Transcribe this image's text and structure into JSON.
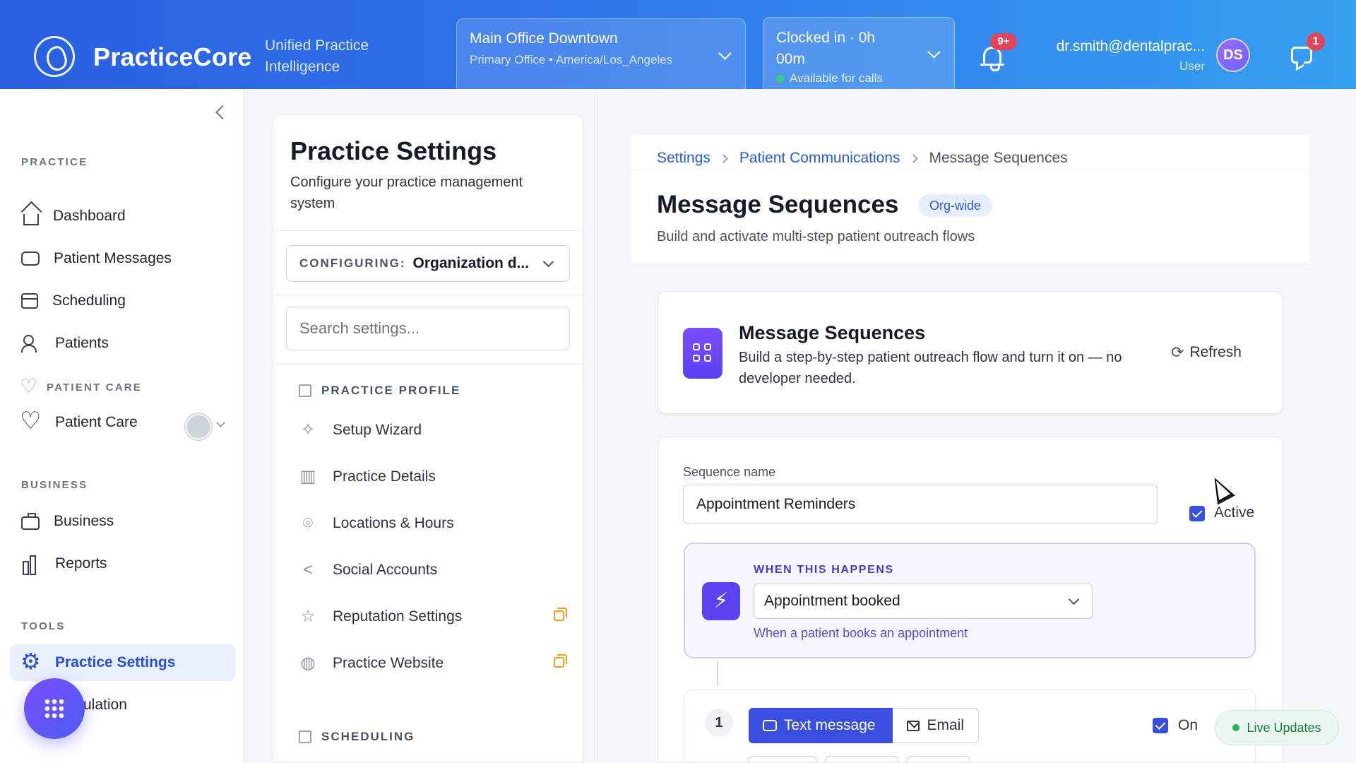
{
  "header": {
    "brand": "PracticeCore",
    "tagline": "Unified Practice Intelligence",
    "location": {
      "name": "Main Office Downtown",
      "sub": "Primary Office • America/Los_Angeles"
    },
    "clock": {
      "status": "Clocked in · 0h 00m",
      "availability": "Available for calls"
    },
    "notifications_badge": "9+",
    "user": {
      "email": "dr.smith@dentalprac...",
      "role": "User",
      "initials": "DS"
    },
    "messages_badge": "1"
  },
  "sidebar": {
    "sections": [
      {
        "label": "PRACTICE"
      },
      {
        "label": "PATIENT CARE"
      },
      {
        "label": "BUSINESS"
      },
      {
        "label": "TOOLS"
      }
    ],
    "items": {
      "dashboard": "Dashboard",
      "patient_messages": "Patient Messages",
      "scheduling": "Scheduling",
      "patients": "Patients",
      "patient_care": "Patient Care",
      "business": "Business",
      "reports": "Reports",
      "practice_settings": "Practice Settings",
      "simulation_partial": "ulation"
    }
  },
  "settings_panel": {
    "title": "Practice Settings",
    "subtitle": "Configure your practice management system",
    "configuring_label": "CONFIGURING:",
    "configuring_value": "Organization d...",
    "search_placeholder": "Search settings...",
    "groups": {
      "practice_profile": "PRACTICE PROFILE",
      "scheduling": "SCHEDULING"
    },
    "items": [
      {
        "label": "Setup Wizard",
        "icon": "sparkles-icon"
      },
      {
        "label": "Practice Details",
        "icon": "building-icon"
      },
      {
        "label": "Locations & Hours",
        "icon": "map-pin-icon"
      },
      {
        "label": "Social Accounts",
        "icon": "share-icon"
      },
      {
        "label": "Reputation Settings",
        "icon": "star-icon"
      },
      {
        "label": "Practice Website",
        "icon": "globe-icon"
      }
    ]
  },
  "main": {
    "breadcrumb": [
      "Settings",
      "Patient Communications",
      "Message Sequences"
    ],
    "title": "Message Sequences",
    "badge": "Org-wide",
    "subtitle": "Build and activate multi-step patient outreach flows",
    "info_card": {
      "title": "Message Sequences",
      "description": "Build a step-by-step patient outreach flow and turn it on — no developer needed.",
      "refresh_label": "Refresh"
    },
    "sequence": {
      "name_label": "Sequence name",
      "name_value": "Appointment Reminders",
      "active_label": "Active",
      "active": true,
      "trigger_label": "WHEN THIS HAPPENS",
      "trigger_value": "Appointment booked",
      "trigger_help": "When a patient books an appointment",
      "step": {
        "number": "1",
        "channel_sms": "Text message",
        "channel_email": "Email",
        "selected_channel": "Text message",
        "on_label": "On",
        "on": true
      }
    },
    "live_updates": "Live Updates"
  },
  "colors": {
    "header_gradient_start": "#2a5fe0",
    "header_gradient_end": "#36a0f0",
    "accent": "#3a4fe0",
    "purple": "#5a42f0",
    "badge_red": "#e2455a",
    "live_green": "#22b45e"
  }
}
